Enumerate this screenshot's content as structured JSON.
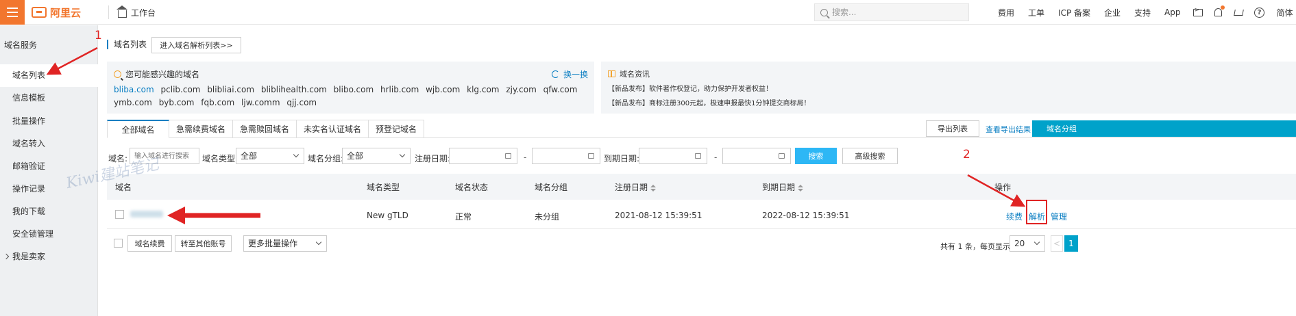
{
  "topbar": {
    "logo_text": "阿里云",
    "workbench_label": "工作台",
    "search_placeholder": "搜索...",
    "nav": [
      "费用",
      "工单",
      "ICP 备案",
      "企业",
      "支持",
      "App"
    ],
    "user_label": "简体",
    "icons": [
      "menu-icon",
      "home-icon",
      "search-icon",
      "terminal-icon",
      "bell-icon",
      "cart-icon",
      "help-icon"
    ],
    "accent": "#f2762e"
  },
  "sidebar": {
    "title": "域名服务",
    "items": [
      {
        "label": "域名列表",
        "active": true
      },
      {
        "label": "信息模板"
      },
      {
        "label": "批量操作"
      },
      {
        "label": "域名转入"
      },
      {
        "label": "邮箱验证"
      },
      {
        "label": "操作记录"
      },
      {
        "label": "我的下载"
      },
      {
        "label": "安全锁管理"
      },
      {
        "label": "我是卖家"
      }
    ]
  },
  "header": {
    "title": "域名列表",
    "dns_button": "进入域名解析列表>>"
  },
  "interest_panel": {
    "title": "您可能感兴趣的域名",
    "refresh": "换一换",
    "domains": [
      "bliba.com",
      "pclib.com",
      "blibliai.com",
      "bliblihealth.com",
      "blibo.com",
      "hrlib.com",
      "wjb.com",
      "klg.com",
      "zjy.com",
      "qfw.com",
      "ymb.com",
      "byb.com",
      "fqb.com",
      "ljw.comm",
      "qjj.com"
    ]
  },
  "news_panel": {
    "title": "域名资讯",
    "items": [
      "【新品发布】软件著作权登记，助力保护开发者权益！",
      "【新品发布】商标注册300元起，极速申报最快1分钟提交商标局！"
    ]
  },
  "tabs": [
    "全部域名",
    "急需续费域名",
    "急需赎回域名",
    "未实名认证域名",
    "预登记域名"
  ],
  "actions": {
    "export": "导出列表",
    "view_export": "查看导出结果",
    "group": "域名分组"
  },
  "filters": {
    "domain_label": "域名:",
    "domain_placeholder": "输入域名进行搜索",
    "type_label": "域名类型:",
    "type_value": "全部",
    "group_label": "域名分组:",
    "group_value": "全部",
    "reg_label": "注册日期:",
    "exp_label": "到期日期:",
    "dash": "-",
    "search_btn": "搜索",
    "advanced_btn": "高级搜索"
  },
  "table": {
    "headers": [
      "域名",
      "域名类型",
      "域名状态",
      "域名分组",
      "注册日期",
      "到期日期",
      "操作"
    ],
    "rows": [
      {
        "type": "New gTLD",
        "status": "正常",
        "group": "未分组",
        "registered": "2021-08-12 15:39:51",
        "expires": "2022-08-12 15:39:51",
        "ops": [
          "续费",
          "解析",
          "管理"
        ]
      }
    ]
  },
  "footer": {
    "renew_btn": "域名续费",
    "transfer_btn": "转至其他账号",
    "batch_select": "更多批量操作",
    "summary": "共有 1 条，每页显示:",
    "page_size": "20",
    "prev": "<",
    "current_page": "1"
  },
  "annotations": {
    "step1": "1",
    "step2": "2",
    "color": "#e02424"
  },
  "watermark": "Kiwi建站笔记"
}
